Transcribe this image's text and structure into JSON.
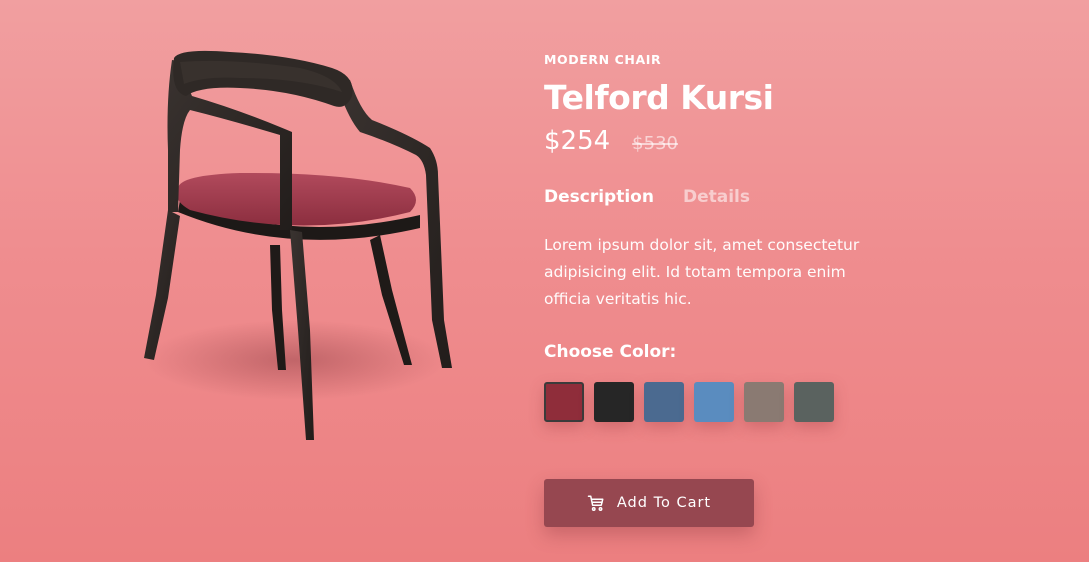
{
  "product": {
    "category": "MODERN CHAIR",
    "name": "Telford Kursi",
    "price_current": "$254",
    "price_old": "$530"
  },
  "tabs": [
    {
      "label": "Description",
      "active": true
    },
    {
      "label": "Details",
      "active": false
    }
  ],
  "description": "Lorem ipsum dolor sit, amet consectetur adipisicing elit. Id totam tempora enim officia veritatis hic.",
  "color_picker": {
    "label": "Choose Color:",
    "swatches": [
      {
        "name": "crimson-fabric",
        "color": "#8f2d3a",
        "selected": true
      },
      {
        "name": "black-fabric",
        "color": "#262626",
        "selected": false
      },
      {
        "name": "denim-fabric",
        "color": "#4b6a90",
        "selected": false
      },
      {
        "name": "sky-blue-fabric",
        "color": "#5a8cbf",
        "selected": false
      },
      {
        "name": "taupe-fabric",
        "color": "#8a7a72",
        "selected": false
      },
      {
        "name": "slate-fabric",
        "color": "#5a625f",
        "selected": false
      }
    ]
  },
  "cart_button": {
    "label": "Add To Cart",
    "icon": "cart-icon"
  },
  "colors": {
    "background": "#ef8d8f",
    "button": "#964750",
    "chair_frame": "#2b2624",
    "chair_seat": "#a0384a"
  }
}
